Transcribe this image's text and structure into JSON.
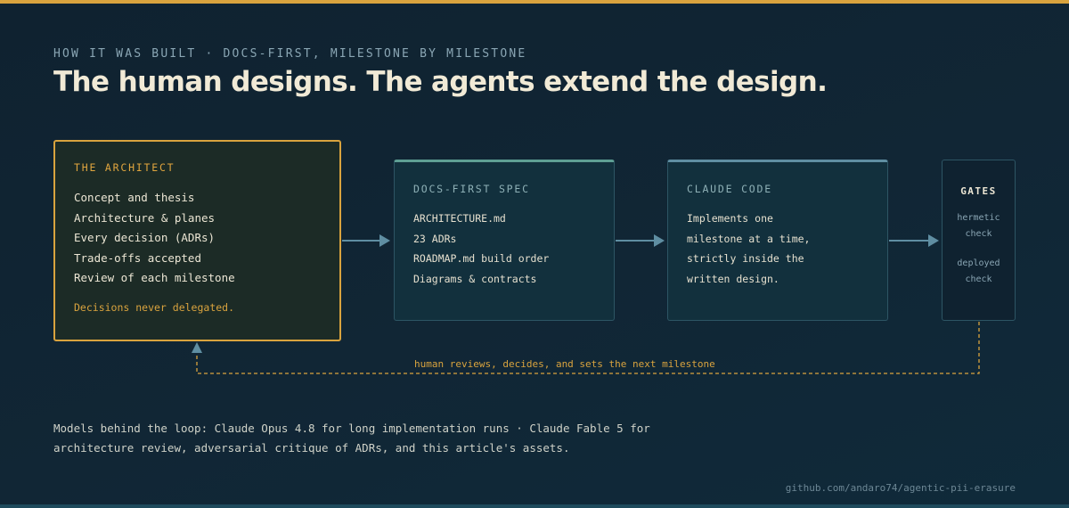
{
  "header": {
    "eyebrow": "HOW IT WAS BUILT · DOCS-FIRST, MILESTONE BY MILESTONE",
    "title": "The human designs. The agents extend the design."
  },
  "architect": {
    "title": "THE ARCHITECT",
    "items": [
      "Concept and thesis",
      "Architecture & planes",
      "Every decision (ADRs)",
      "Trade-offs accepted",
      "Review of each milestone"
    ],
    "note": "Decisions never delegated."
  },
  "spec": {
    "title": "DOCS-FIRST SPEC",
    "items": [
      "ARCHITECTURE.md",
      "23 ADRs",
      "ROADMAP.md build order",
      "Diagrams & contracts"
    ]
  },
  "claude": {
    "title": "CLAUDE CODE",
    "lines": [
      "Implements one",
      "milestone at a time,",
      "strictly inside the",
      "written design."
    ]
  },
  "gates": {
    "title": "GATES",
    "check1": [
      "hermetic",
      "check"
    ],
    "check2": [
      "deployed",
      "check"
    ]
  },
  "loop": {
    "label": "human reviews, decides, and sets the next milestone"
  },
  "footer": {
    "models_line1": "Models behind the loop: Claude Opus 4.8 for long implementation runs · Claude Fable 5 for",
    "models_line2": "architecture review, adversarial critique of ADRs, and this article's assets.",
    "repo": "github.com/andaro74/agentic-pii-erasure"
  },
  "colors": {
    "accent": "#d9a33e",
    "background": "#112635",
    "spec_accent": "#5e9f94",
    "claude_accent": "#5f8ea2",
    "arrow": "#5f8ea2"
  }
}
